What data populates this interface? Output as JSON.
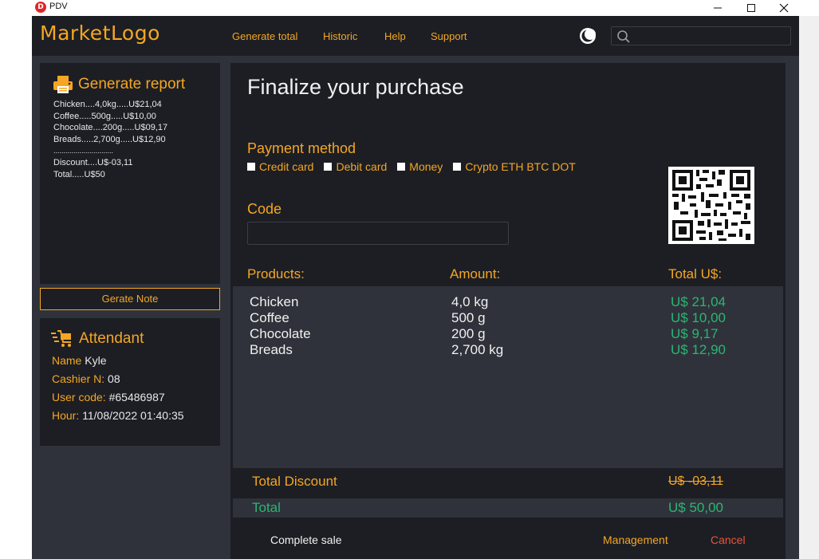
{
  "window": {
    "app_icon_letter": "D",
    "title": "PDV"
  },
  "header": {
    "logo": "MarketLogo",
    "nav": [
      "Generate total",
      "Historic",
      "Help",
      "Support"
    ],
    "search_value": ""
  },
  "report": {
    "title": "Generate report",
    "lines": [
      "Chicken....4,0kg.....U$21,04",
      "Coffee.....500g.....U$10,00",
      "Chocolate....200g.....U$09,17",
      "Breads.....2,700g.....U$12,90",
      "..............................",
      "Discount....U$-03,11",
      "Total.....U$50"
    ],
    "note_button": "Gerate Note"
  },
  "attendant": {
    "title": "Attendant",
    "rows": [
      {
        "key": "Name",
        "value": "Kyle"
      },
      {
        "key": "Cashier N:",
        "value": "08"
      },
      {
        "key": "User code:",
        "value": "#65486987"
      },
      {
        "key": "Hour:",
        "value": "11/08/2022 01:40:35"
      }
    ]
  },
  "purchase": {
    "title": "Finalize your purchase",
    "payment_label": "Payment method",
    "payment_options": [
      "Credit card",
      "Debit card",
      "Money",
      "Crypto ETH BTC DOT"
    ],
    "code_label": "Code",
    "code_value": "",
    "columns": {
      "products": "Products:",
      "amount": "Amount:",
      "total": "Total U$:"
    },
    "items": [
      {
        "product": "Chicken",
        "amount": "4,0 kg",
        "total": "U$ 21,04"
      },
      {
        "product": "Coffee",
        "amount": "500 g",
        "total": "U$ 10,00"
      },
      {
        "product": "Chocolate",
        "amount": "200 g",
        "total": "U$ 9,17"
      },
      {
        "product": "Breads",
        "amount": "2,700 kg",
        "total": "U$ 12,90"
      }
    ],
    "discount_label": "Total Discount",
    "discount_value": "U$ -03,11",
    "total_label": "Total",
    "total_value": "U$ 50,00",
    "actions": {
      "complete": "Complete sale",
      "management": "Management",
      "cancel": "Cancel"
    }
  },
  "colors": {
    "accent": "#f5a623",
    "success": "#2bb673",
    "danger": "#e8553a",
    "panel": "#1c1e24",
    "background": "#2f323a"
  },
  "icons": [
    "printer-icon",
    "cart-icon",
    "moon-icon",
    "search-icon",
    "qr-code-icon",
    "minimize-icon",
    "maximize-icon",
    "close-icon"
  ]
}
